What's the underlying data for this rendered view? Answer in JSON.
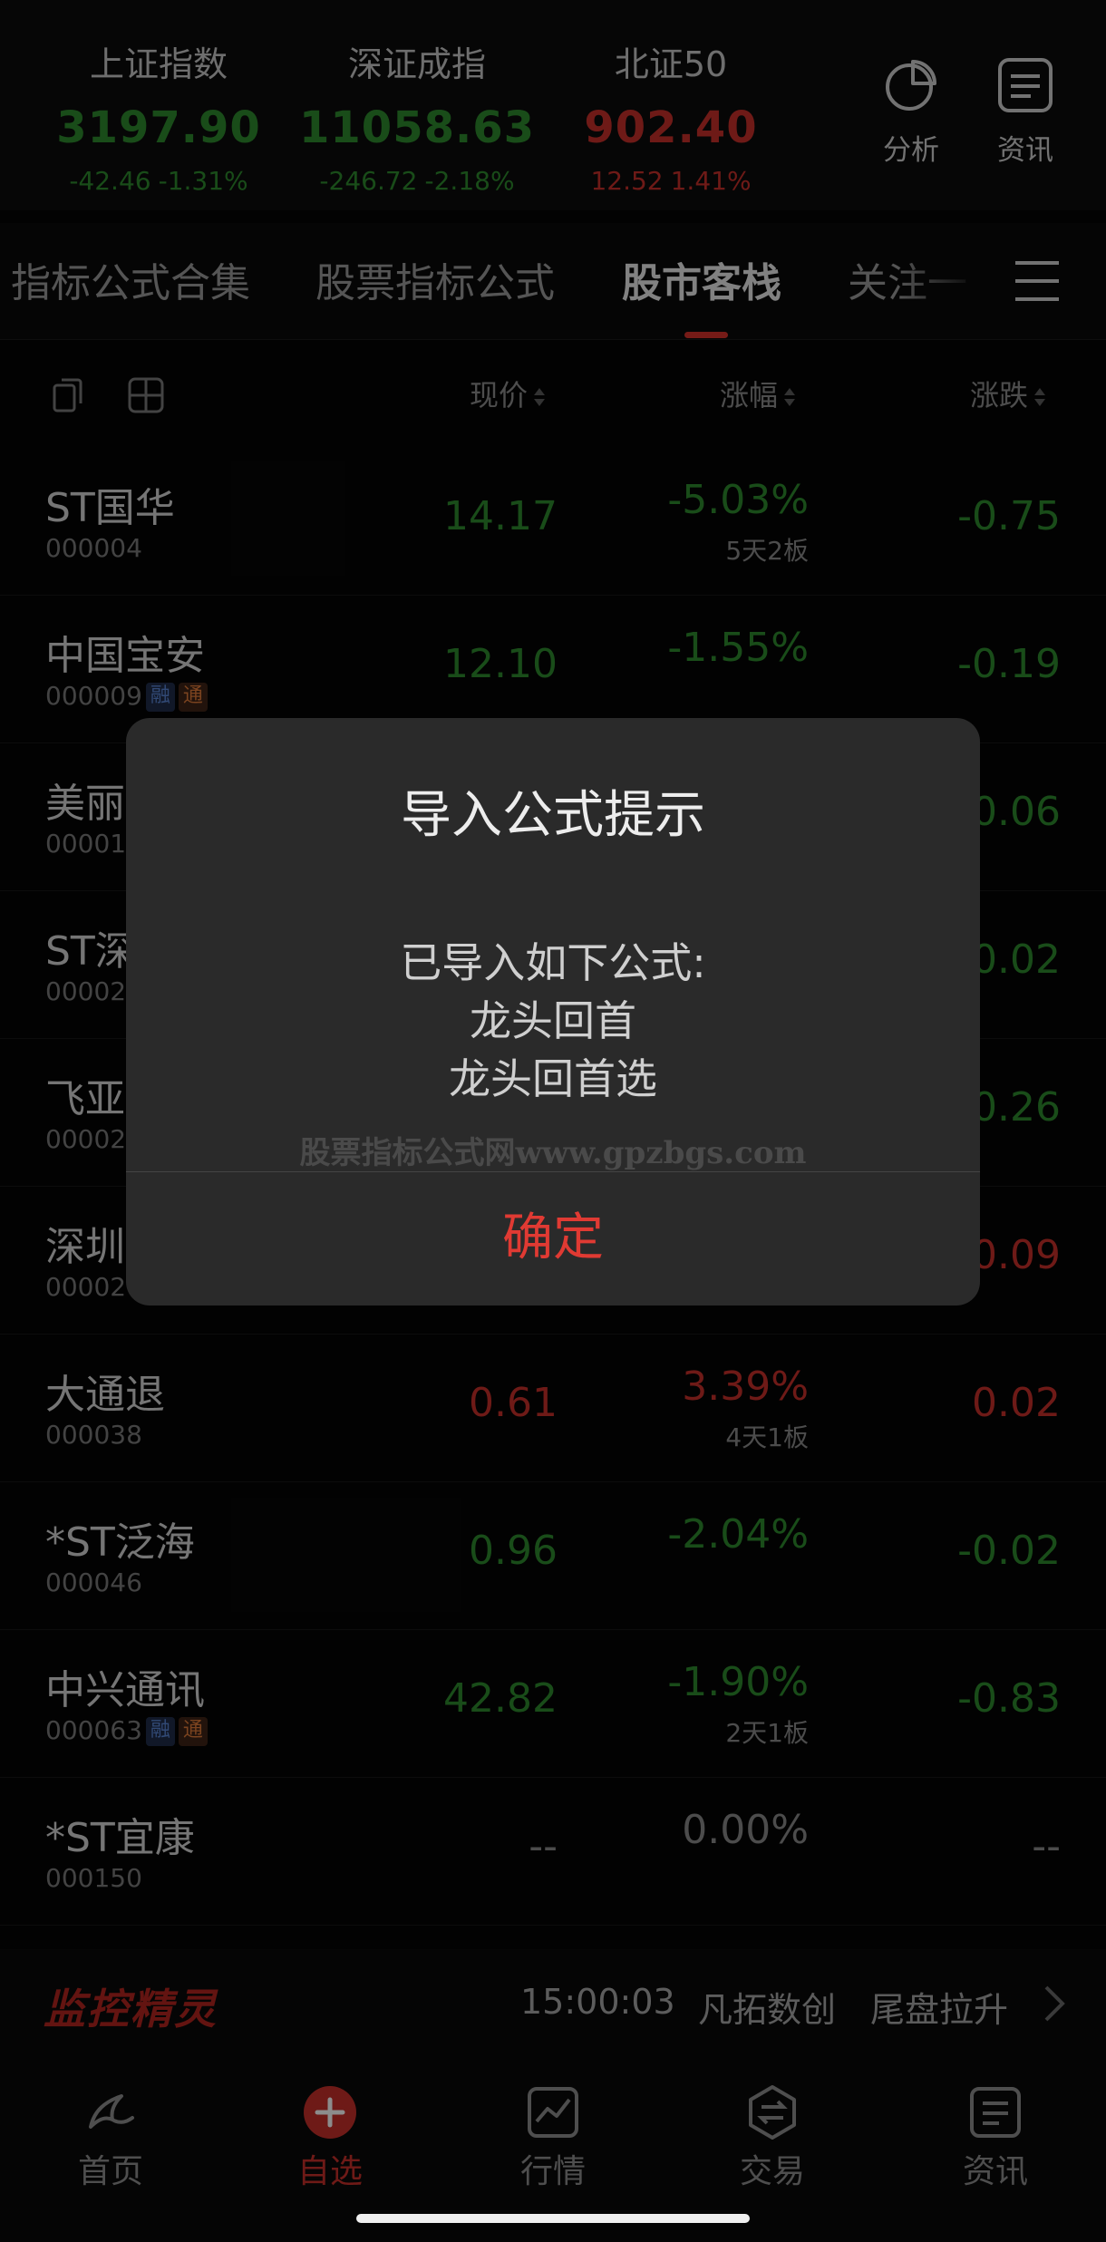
{
  "indices": [
    {
      "name": "上证指数",
      "value": "3197.90",
      "change": "-42.46",
      "pct": "-1.31%",
      "trend": "down"
    },
    {
      "name": "深证成指",
      "value": "11058.63",
      "change": "-246.72",
      "pct": "-2.18%",
      "trend": "down"
    },
    {
      "name": "北证50",
      "value": "902.40",
      "change": "12.52",
      "pct": "1.41%",
      "trend": "up"
    }
  ],
  "header_buttons": {
    "analysis": "分析",
    "news": "资讯"
  },
  "tabs": [
    {
      "label": "指标公式合集",
      "active": false
    },
    {
      "label": "股票指标公式",
      "active": false
    },
    {
      "label": "股市客栈",
      "active": true
    },
    {
      "label": "关注一",
      "active": false
    }
  ],
  "columns": {
    "price": "现价",
    "pct": "涨幅",
    "change": "涨跌"
  },
  "stocks": [
    {
      "name": "ST国华",
      "code": "000004",
      "tags": [],
      "price": "14.17",
      "pct": "-5.03%",
      "note": "5天2板",
      "change": "-0.75",
      "trend": "down"
    },
    {
      "name": "中国宝安",
      "code": "000009",
      "tags": [
        "融",
        "通"
      ],
      "price": "12.10",
      "pct": "-1.55%",
      "note": "",
      "change": "-0.19",
      "trend": "down"
    },
    {
      "name": "美丽",
      "code": "00001",
      "tags": [],
      "price": "",
      "pct": "",
      "note": "",
      "change": "0.06",
      "trend": "down"
    },
    {
      "name": "ST深",
      "code": "00002",
      "tags": [],
      "price": "",
      "pct": "",
      "note": "",
      "change": "0.02",
      "trend": "down"
    },
    {
      "name": "飞亚",
      "code": "00002",
      "tags": [],
      "price": "",
      "pct": "",
      "note": "",
      "change": "0.26",
      "trend": "down"
    },
    {
      "name": "深圳",
      "code": "00002",
      "tags": [],
      "price": "",
      "pct": "",
      "note": "",
      "change": "0.09",
      "trend": "up"
    },
    {
      "name": "大通退",
      "code": "000038",
      "tags": [],
      "price": "0.61",
      "pct": "3.39%",
      "note": "4天1板",
      "change": "0.02",
      "trend": "up"
    },
    {
      "name": "*ST泛海",
      "code": "000046",
      "tags": [],
      "price": "0.96",
      "pct": "-2.04%",
      "note": "",
      "change": "-0.02",
      "trend": "down"
    },
    {
      "name": "中兴通讯",
      "code": "000063",
      "tags": [
        "融",
        "通"
      ],
      "price": "42.82",
      "pct": "-1.90%",
      "note": "2天1板",
      "change": "-0.83",
      "trend": "down"
    },
    {
      "name": "*ST宜康",
      "code": "000150",
      "tags": [],
      "price": "--",
      "pct": "0.00%",
      "note": "",
      "change": "--",
      "trend": "flat"
    }
  ],
  "ticker": {
    "logo": "监控精灵",
    "time": "15:00:03",
    "stock": "凡拓数创",
    "event": "尾盘拉升"
  },
  "nav": [
    {
      "label": "首页",
      "icon": "home-icon",
      "active": false
    },
    {
      "label": "自选",
      "icon": "add-watchlist-icon",
      "active": true
    },
    {
      "label": "行情",
      "icon": "market-chart-icon",
      "active": false
    },
    {
      "label": "交易",
      "icon": "trade-exchange-icon",
      "active": false
    },
    {
      "label": "资讯",
      "icon": "news-icon",
      "active": false
    }
  ],
  "dialog": {
    "title": "导入公式提示",
    "message_lines": [
      "已导入如下公式:",
      "龙头回首",
      "龙头回首选"
    ],
    "watermark": "股票指标公式网www.gpzbgs.com",
    "confirm": "确定"
  },
  "colors": {
    "up": "#c8312b",
    "down": "#2e8b2e",
    "flat": "#8a8a8a",
    "accent": "#e03a33"
  }
}
